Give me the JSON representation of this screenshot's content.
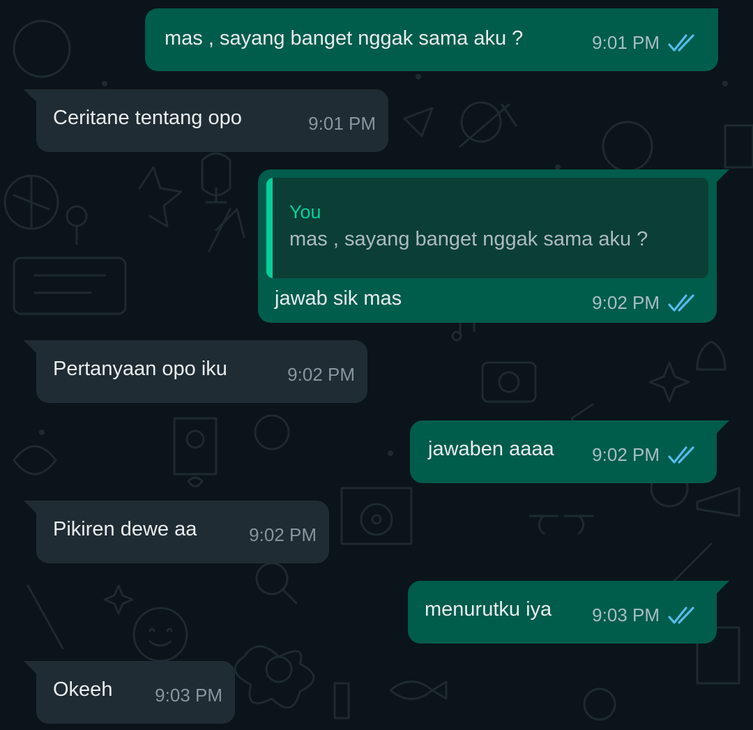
{
  "colors": {
    "background": "#0b141a",
    "incoming_bubble": "#202c33",
    "outgoing_bubble": "#005c4b",
    "quote_accent": "#06cf9c",
    "read_ticks": "#53bdeb"
  },
  "messages": [
    {
      "direction": "out",
      "text": "mas , sayang banget nggak sama aku ?",
      "time": "9:01 PM",
      "status_icon": "double-check-read-icon"
    },
    {
      "direction": "in",
      "text": "Ceritane tentang opo",
      "time": "9:01 PM"
    },
    {
      "direction": "out",
      "text": "jawab sik mas",
      "time": "9:02 PM",
      "status_icon": "double-check-read-icon",
      "quote": {
        "author": "You",
        "text": "mas , sayang banget nggak sama aku ?"
      }
    },
    {
      "direction": "in",
      "text": "Pertanyaan opo iku",
      "time": "9:02 PM"
    },
    {
      "direction": "out",
      "text": "jawaben aaaa",
      "time": "9:02 PM",
      "status_icon": "double-check-read-icon"
    },
    {
      "direction": "in",
      "text": "Pikiren dewe aa",
      "time": "9:02 PM"
    },
    {
      "direction": "out",
      "text": "menurutku iya",
      "time": "9:03 PM",
      "status_icon": "double-check-read-icon"
    },
    {
      "direction": "in",
      "text": "Okeeh",
      "time": "9:03 PM"
    }
  ]
}
